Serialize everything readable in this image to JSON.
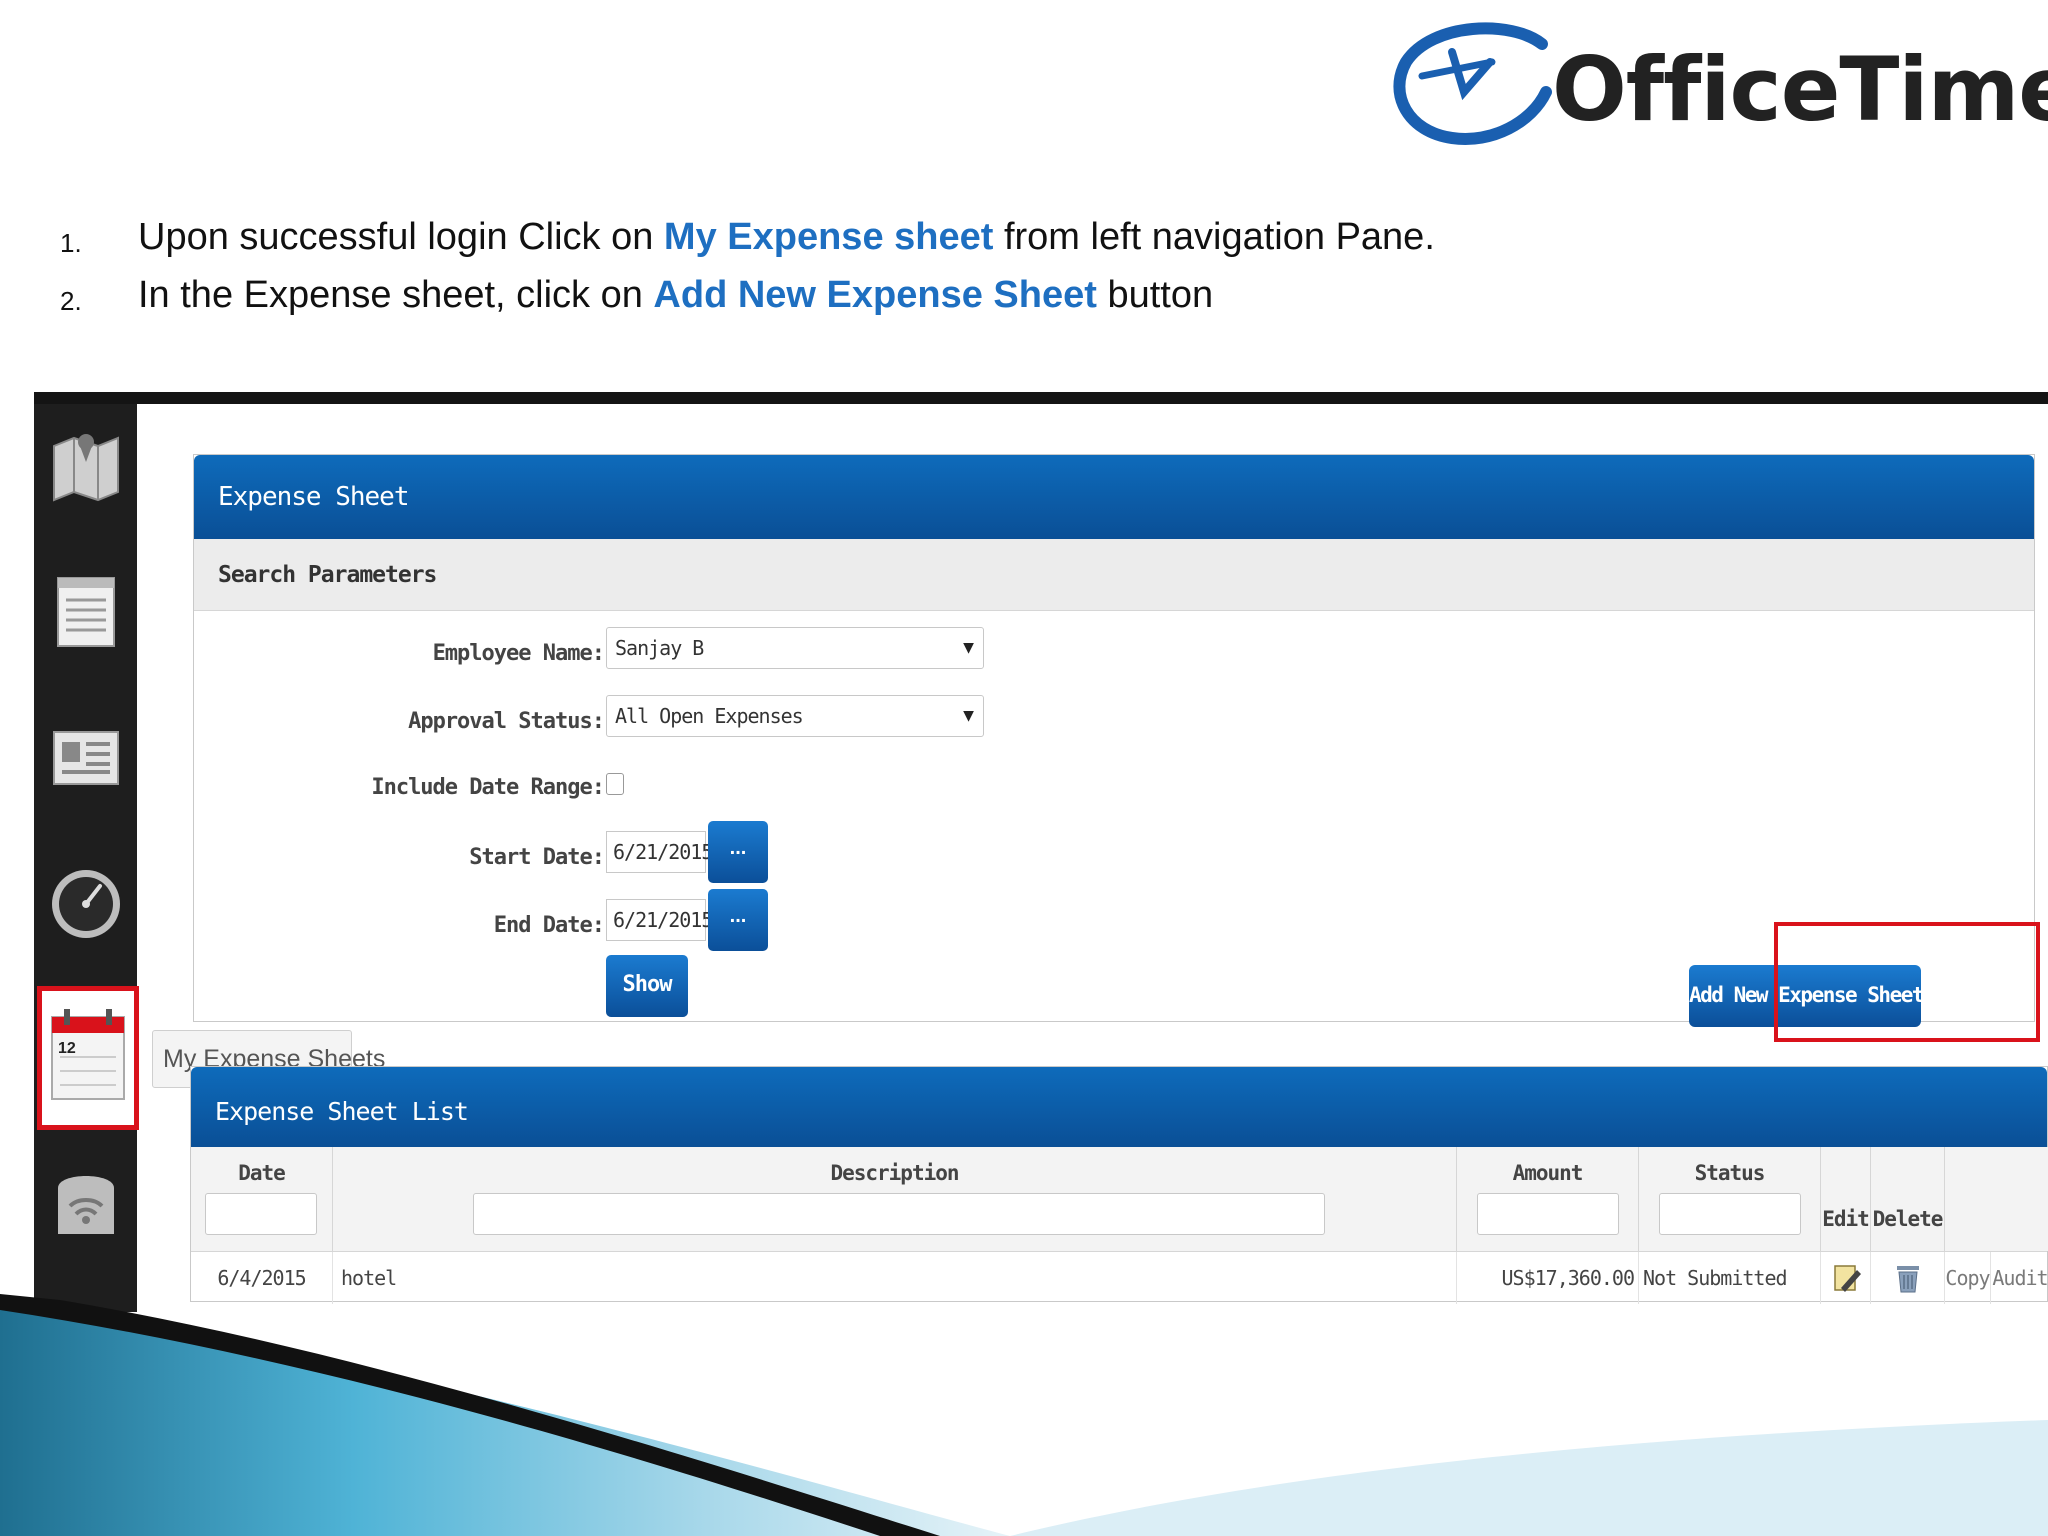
{
  "logo": {
    "text": "OfficeTimer"
  },
  "instructions": [
    {
      "num": "1.",
      "pre": "Upon successful login Click on ",
      "highlight": "My Expense sheet",
      "post": " from left navigation Pane."
    },
    {
      "num": "2.",
      "pre": "In the Expense sheet, click on ",
      "highlight": "Add New Expense Sheet",
      "post": " button"
    }
  ],
  "nav": {
    "icons": [
      "map-icon",
      "document-icon",
      "contact-card-icon",
      "speedometer-icon",
      "calendar-icon",
      "cloud-upload-icon"
    ],
    "calendar_day": "12",
    "tooltip": "My Expense Sheets"
  },
  "expense_sheet": {
    "title": "Expense Sheet",
    "search_title": "Search Parameters",
    "employee_label": "Employee Name:",
    "employee_value": "Sanjay B",
    "approval_label": "Approval Status:",
    "approval_value": "All Open Expenses",
    "include_label": "Include Date Range:",
    "start_label": "Start Date:",
    "start_value": "6/21/2015",
    "end_label": "End Date:",
    "end_value": "6/21/2015",
    "date_btn": "...",
    "show_btn": "Show",
    "add_btn": "Add New Expense Sheet"
  },
  "list": {
    "title": "Expense Sheet List",
    "columns": {
      "date": "Date",
      "description": "Description",
      "amount": "Amount",
      "status": "Status",
      "edit": "Edit",
      "delete": "Delete"
    },
    "rows": [
      {
        "date": "6/4/2015",
        "description": "hotel",
        "amount": "US$17,360.00",
        "status": "Not Submitted",
        "copy": "Copy",
        "audit": "Audit"
      }
    ]
  },
  "colors": {
    "brand_blue": "#0a5aa8",
    "highlight_red": "#d9121b",
    "text_highlight": "#1e6fc1"
  }
}
